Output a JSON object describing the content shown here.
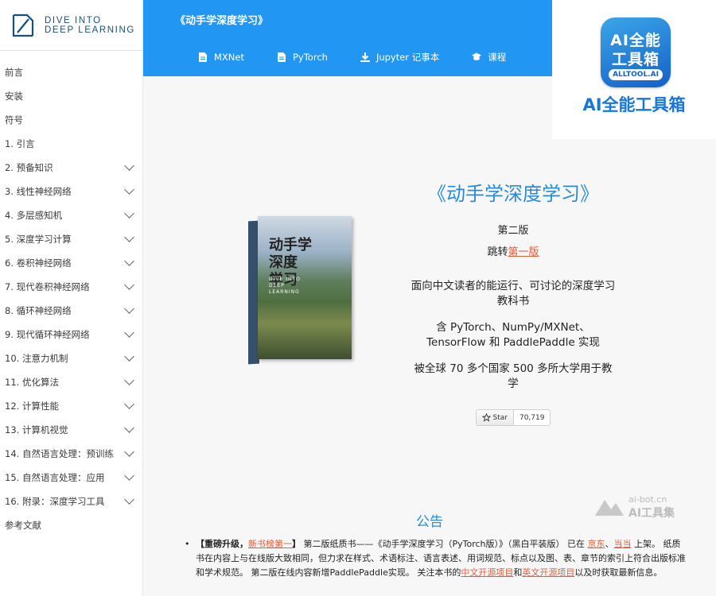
{
  "logo": {
    "line1": "DIVE INTO",
    "line2": "DEEP LEARNING"
  },
  "sidebar": {
    "items": [
      {
        "label": "前言",
        "expandable": false
      },
      {
        "label": "安装",
        "expandable": false
      },
      {
        "label": "符号",
        "expandable": false
      },
      {
        "label": "1. 引言",
        "expandable": false
      },
      {
        "label": "2. 预备知识",
        "expandable": true
      },
      {
        "label": "3. 线性神经网络",
        "expandable": true
      },
      {
        "label": "4. 多层感知机",
        "expandable": true
      },
      {
        "label": "5. 深度学习计算",
        "expandable": true
      },
      {
        "label": "6. 卷积神经网络",
        "expandable": true
      },
      {
        "label": "7. 现代卷积神经网络",
        "expandable": true
      },
      {
        "label": "8. 循环神经网络",
        "expandable": true
      },
      {
        "label": "9. 现代循环神经网络",
        "expandable": true
      },
      {
        "label": "10. 注意力机制",
        "expandable": true
      },
      {
        "label": "11. 优化算法",
        "expandable": true
      },
      {
        "label": "12. 计算性能",
        "expandable": true
      },
      {
        "label": "13. 计算机视觉",
        "expandable": true
      },
      {
        "label": "14. 自然语言处理：预训练",
        "expandable": true
      },
      {
        "label": "15. 自然语言处理：应用",
        "expandable": true
      },
      {
        "label": "16. 附录：深度学习工具",
        "expandable": true
      },
      {
        "label": "参考文献",
        "expandable": false
      }
    ]
  },
  "header": {
    "title": "《动手学深度学习》",
    "nav": [
      {
        "label": "MXNet",
        "icon": "file-icon"
      },
      {
        "label": "PyTorch",
        "icon": "file-icon"
      },
      {
        "label": "Jupyter 记事本",
        "icon": "download-icon"
      },
      {
        "label": "课程",
        "icon": "graduation-cap-icon"
      }
    ]
  },
  "badge": {
    "icon_line1": "AI全能",
    "icon_line2": "工具箱",
    "icon_pill": "ALLTOOL.AI",
    "text": "AI全能工具箱"
  },
  "book": {
    "cover_title": "动手学\n深度\n学习",
    "cover_en": "DIVE INTO\nDEEP\nLEARNING"
  },
  "hero": {
    "title": "《动手学深度学习》",
    "edition": "第二版",
    "jump_prefix": "跳转",
    "jump_link": "第一版",
    "p1": "面向中文读者的能运行、可讨论的深度学习教科书",
    "p2": "含 PyTorch、NumPy/MXNet、TensorFlow 和 PaddlePaddle 实现",
    "p3": "被全球 70 多个国家 500 多所大学用于教学",
    "star_label": "Star",
    "star_count": "70,719"
  },
  "watermark": {
    "line1": "ai-bot.cn",
    "line2": "AI工具集"
  },
  "announcement": {
    "title": "公告",
    "bold_open": "【重磅升级，",
    "link_bestseller": "新书榜第一",
    "bold_close": "】",
    "t1": " 第二版纸质书——《动手学深度学习（PyTorch版）》（黑白平装版） 已在 ",
    "link_jd": "京东",
    "t2": "、",
    "link_dd": "当当",
    "t3": " 上架。 纸质书在内容上与在线版大致相同，但力求在样式、术语标注、语言表述、用词规范、标点以及图、表、章节的索引上符合出版标准和学术规范。 第二版在线内容新增PaddlePaddle实现。 关注本书的",
    "link_cn": "中文开源项目",
    "t4": "和",
    "link_en": "英文开源项目",
    "t5": "以及时获取最新信息。"
  },
  "colors": {
    "header_blue": "#2196f3",
    "title_blue": "#2b8bd6",
    "link_orange": "#e35d3a"
  }
}
